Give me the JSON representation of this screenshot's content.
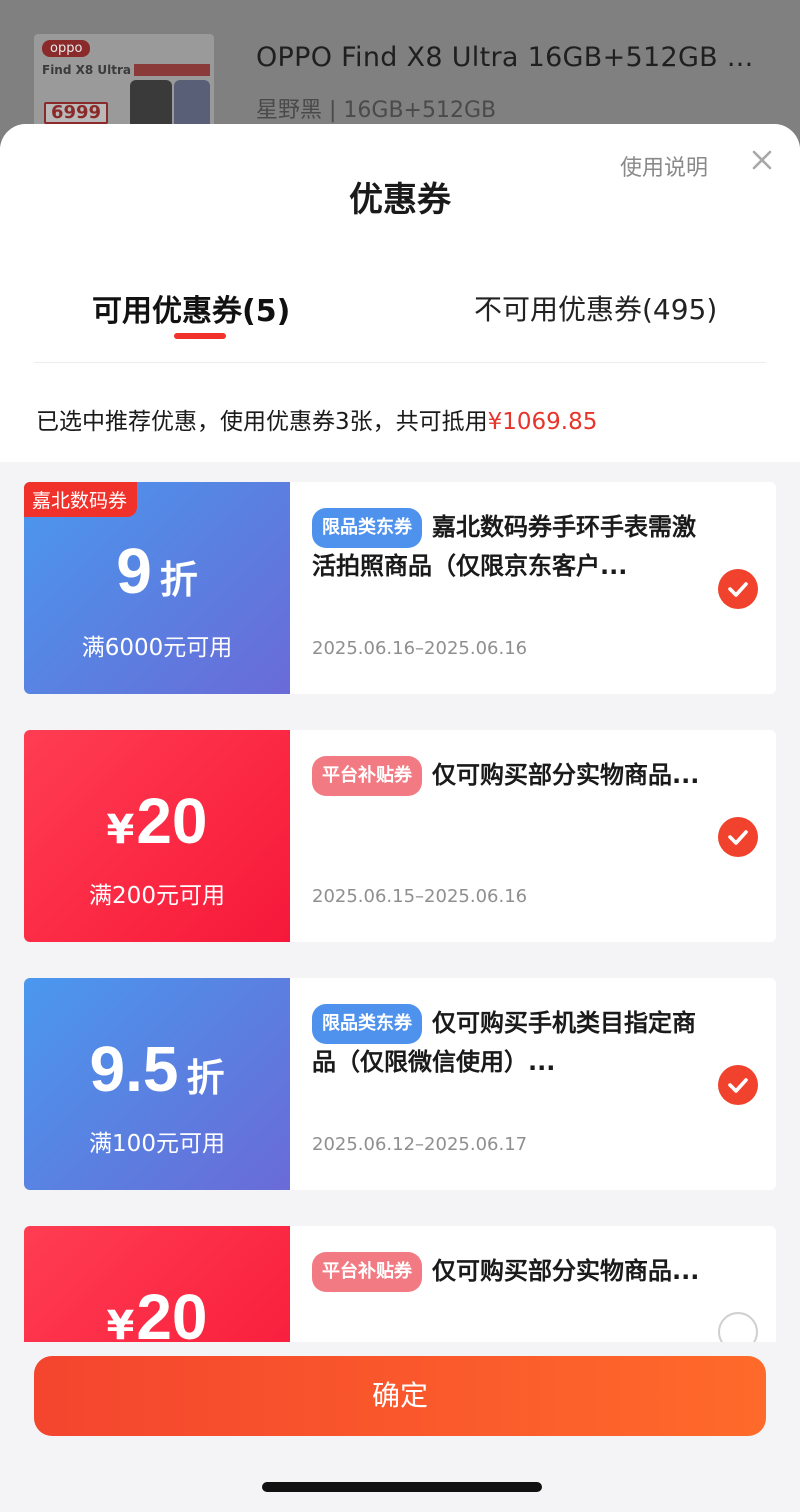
{
  "product": {
    "thumb_logo": "oppo",
    "thumb_model": "Find X8 Ultra",
    "thumb_price": "6999",
    "title": "OPPO Find X8 Ultra 16GB+512GB ...",
    "variant": "星野黑 | 16GB+512GB"
  },
  "sheet": {
    "title": "优惠券",
    "usage_link": "使用说明",
    "tabs": [
      {
        "label": "可用优惠券(5)",
        "active": true
      },
      {
        "label": "不可用优惠券(495)",
        "active": false
      }
    ],
    "summary_prefix": "已选中推荐优惠，使用优惠券3张，共可抵用",
    "summary_amount": "¥1069.85"
  },
  "coupons": [
    {
      "style": "blue",
      "tag": "嘉北数码券",
      "value": "9",
      "unit": "折",
      "condition": "满6000元可用",
      "badge": "限品类东券",
      "description": "嘉北数码券手环手表需激活拍照商品（仅限京东客户...",
      "dates": "2025.06.16–2025.06.16",
      "checked": true
    },
    {
      "style": "red",
      "tag": "",
      "currency": "¥",
      "value": "20",
      "condition": "满200元可用",
      "badge": "平台补贴券",
      "description": "仅可购买部分实物商品...",
      "dates": "2025.06.15–2025.06.16",
      "checked": true
    },
    {
      "style": "blue",
      "tag": "",
      "value": "9.5",
      "unit": "折",
      "condition": "满100元可用",
      "badge": "限品类东券",
      "description": "仅可购买手机类目指定商品（仅限微信使用）...",
      "dates": "2025.06.12–2025.06.17",
      "checked": true
    },
    {
      "style": "red",
      "tag": "",
      "currency": "¥",
      "value": "20",
      "condition": "",
      "badge": "平台补贴券",
      "description": "仅可购买部分实物商品...",
      "dates": "",
      "checked": false
    }
  ],
  "confirm_label": "确定",
  "colors": {
    "accent_red": "#f0322a",
    "amount_red": "#e8352b",
    "coupon_blue": "#5b7fe0",
    "coupon_red": "#fb2742",
    "badge_blue": "#4f92ee",
    "badge_pink": "#f27a83",
    "button_start": "#f4452e",
    "button_end": "#ff6a2a"
  },
  "icons": {
    "close": "close-icon",
    "check": "check-circle-icon",
    "uncheck": "empty-circle-icon"
  }
}
